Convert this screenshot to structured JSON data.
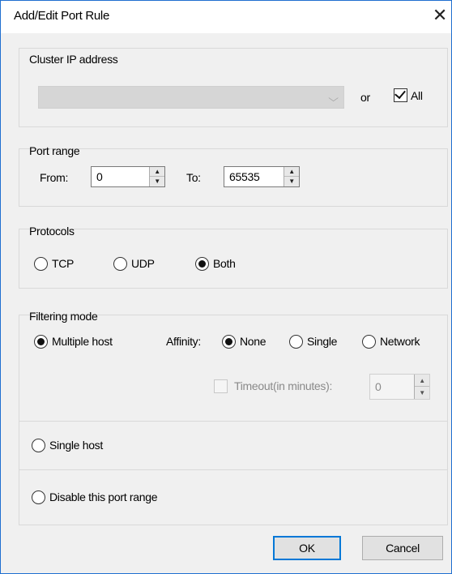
{
  "window": {
    "title": "Add/Edit Port Rule",
    "close_glyph": "✕"
  },
  "cluster_ip": {
    "label": "Cluster IP address",
    "value": "",
    "or_label": "or",
    "all_label": "All",
    "all_checked": true
  },
  "port_range": {
    "label": "Port range",
    "from_label": "From:",
    "from_value": "0",
    "to_label": "To:",
    "to_value": "65535"
  },
  "protocols": {
    "label": "Protocols",
    "options": [
      "TCP",
      "UDP",
      "Both"
    ],
    "selected": "Both"
  },
  "filtering_mode": {
    "label": "Filtering mode",
    "multiple_host_label": "Multiple host",
    "affinity_label": "Affinity:",
    "affinity_options": [
      "None",
      "Single",
      "Network"
    ],
    "affinity_selected": "None",
    "timeout_label": "Timeout(in minutes):",
    "timeout_value": "0",
    "single_host_label": "Single host",
    "disable_label": "Disable this port range",
    "selected": "Multiple host"
  },
  "buttons": {
    "ok": "OK",
    "cancel": "Cancel"
  },
  "icons": {
    "spin_up": "▲",
    "spin_down": "▼",
    "combo_chevron": "⌵"
  },
  "colors": {
    "accent": "#0078d7",
    "dialog_bg": "#f0f0f0",
    "disabled_combo": "#d6d6d6"
  }
}
